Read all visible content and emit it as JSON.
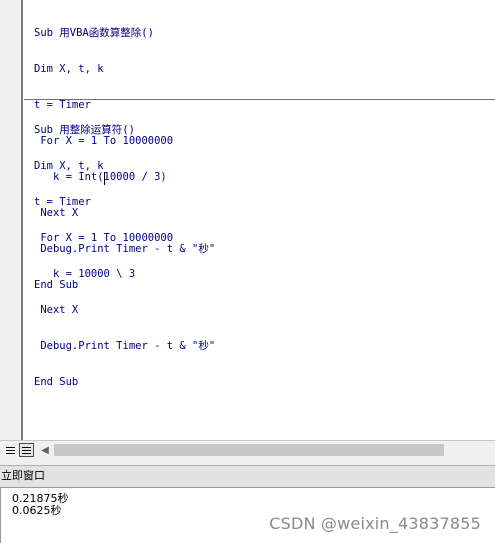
{
  "editor": {
    "procedures": [
      {
        "lines": [
          "Sub 用VBA函数算整除()",
          "Dim X, t, k",
          "t = Timer",
          " For X = 1 To 10000000",
          "   k = Int(10000 / 3)",
          " Next X",
          " Debug.Print Timer - t & \"秒\"",
          "End Sub"
        ]
      },
      {
        "lines": [
          "Sub 用整除运算符()",
          "Dim X, t, k",
          "t = Timer",
          " For X = 1 To 10000000",
          "   k = 10000 \\ 3",
          " Next X",
          " Debug.Print Timer - t & \"秒\"",
          "End Sub"
        ]
      }
    ],
    "view_buttons": [
      "procedure-view-icon",
      "full-module-view-icon"
    ],
    "scroll_left_icon": "scroll-left-arrow-icon"
  },
  "immediate": {
    "title": "立即窗口",
    "lines": [
      "0.21875秒",
      "0.0625秒"
    ]
  },
  "watermark": "CSDN @weixin_43837855",
  "colors": {
    "code_text": "#000080",
    "gutter": "#f0f0f0",
    "title_bar": "#e2e2e2"
  }
}
